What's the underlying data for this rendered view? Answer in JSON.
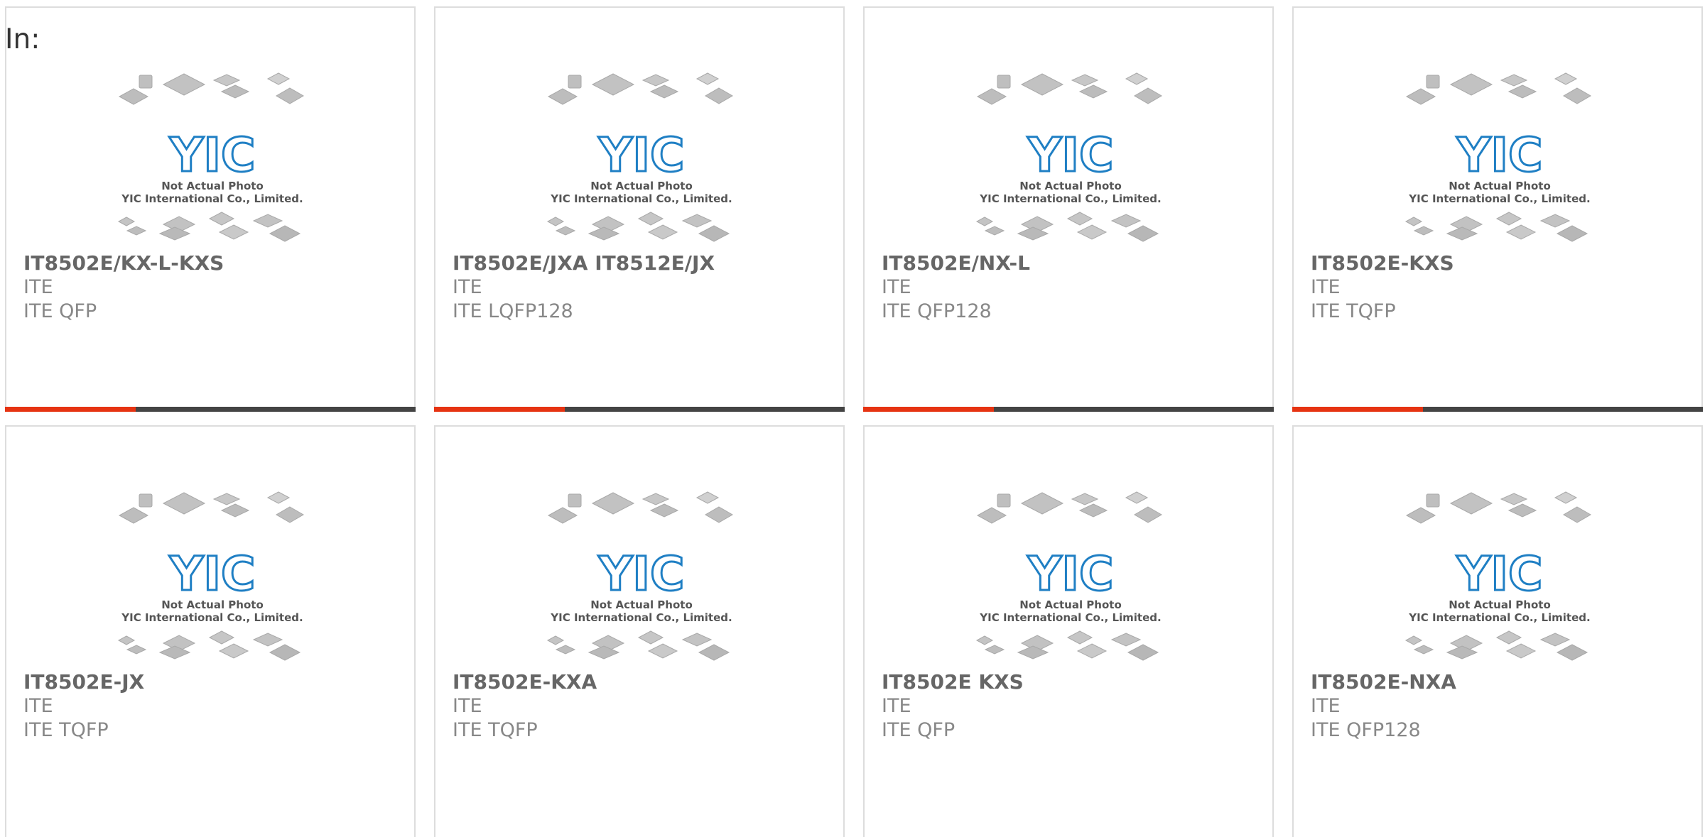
{
  "prefix_label": "In:",
  "colors": {
    "accent": "#e63312",
    "bar": "#444444",
    "logo_blue": "#1f7fc4"
  },
  "placeholder": {
    "line1": "Not Actual Photo",
    "line2": "YIC International Co., Limited.",
    "logo": "YIC"
  },
  "products": [
    {
      "part": "IT8502E/KX-L-KXS",
      "manufacturer": "ITE",
      "package": "ITE QFP"
    },
    {
      "part": "IT8502E/JXA IT8512E/JX",
      "manufacturer": "ITE",
      "package": "ITE LQFP128"
    },
    {
      "part": "IT8502E/NX-L",
      "manufacturer": "ITE",
      "package": "ITE QFP128"
    },
    {
      "part": "IT8502E-KXS",
      "manufacturer": "ITE",
      "package": "ITE TQFP"
    },
    {
      "part": "IT8502E-JX",
      "manufacturer": "ITE",
      "package": "ITE TQFP"
    },
    {
      "part": "IT8502E-KXA",
      "manufacturer": "ITE",
      "package": "ITE TQFP"
    },
    {
      "part": "IT8502E KXS",
      "manufacturer": "ITE",
      "package": "ITE QFP"
    },
    {
      "part": "IT8502E-NXA",
      "manufacturer": "ITE",
      "package": "ITE QFP128"
    }
  ]
}
